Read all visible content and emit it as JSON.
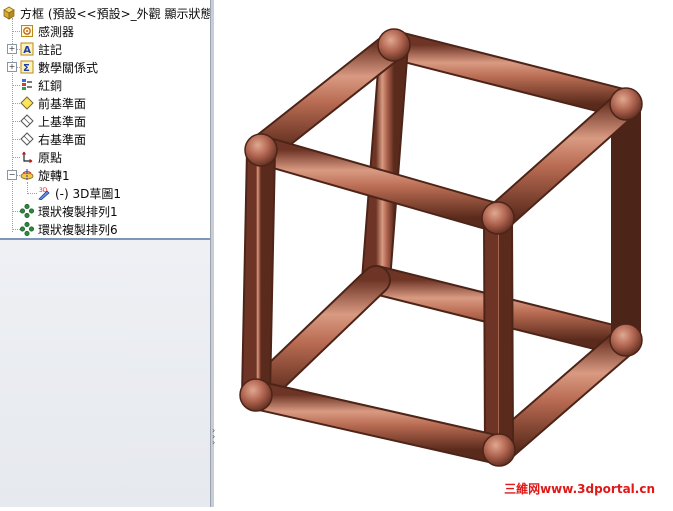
{
  "feature_tree": {
    "root_label": "方框 (預設<<預設>_外觀 顯示狀態",
    "items": [
      {
        "label": "感測器",
        "icon": "sensor-icon"
      },
      {
        "label": "註記",
        "icon": "annotation-icon"
      },
      {
        "label": "數學關係式",
        "icon": "equation-icon"
      },
      {
        "label": "紅銅",
        "icon": "material-icon"
      },
      {
        "label": "前基準面",
        "icon": "plane-icon"
      },
      {
        "label": "上基準面",
        "icon": "plane-icon"
      },
      {
        "label": "右基準面",
        "icon": "plane-icon"
      },
      {
        "label": "原點",
        "icon": "origin-icon"
      },
      {
        "label": "旋轉1",
        "icon": "revolve-icon"
      },
      {
        "label": "(-) 3D草圖1",
        "icon": "3d-sketch-icon"
      },
      {
        "label": "環狀複製排列1",
        "icon": "circular-pattern-icon"
      },
      {
        "label": "環狀複製排列6",
        "icon": "circular-pattern-icon"
      }
    ],
    "sketch_badge": "3D"
  },
  "watermark": "三維网www.3dportal.cn",
  "colors": {
    "copper_light": "#c9826c",
    "copper_mid": "#a85e48",
    "copper_dark": "#6e3526",
    "panel_border": "#7d95b6"
  }
}
